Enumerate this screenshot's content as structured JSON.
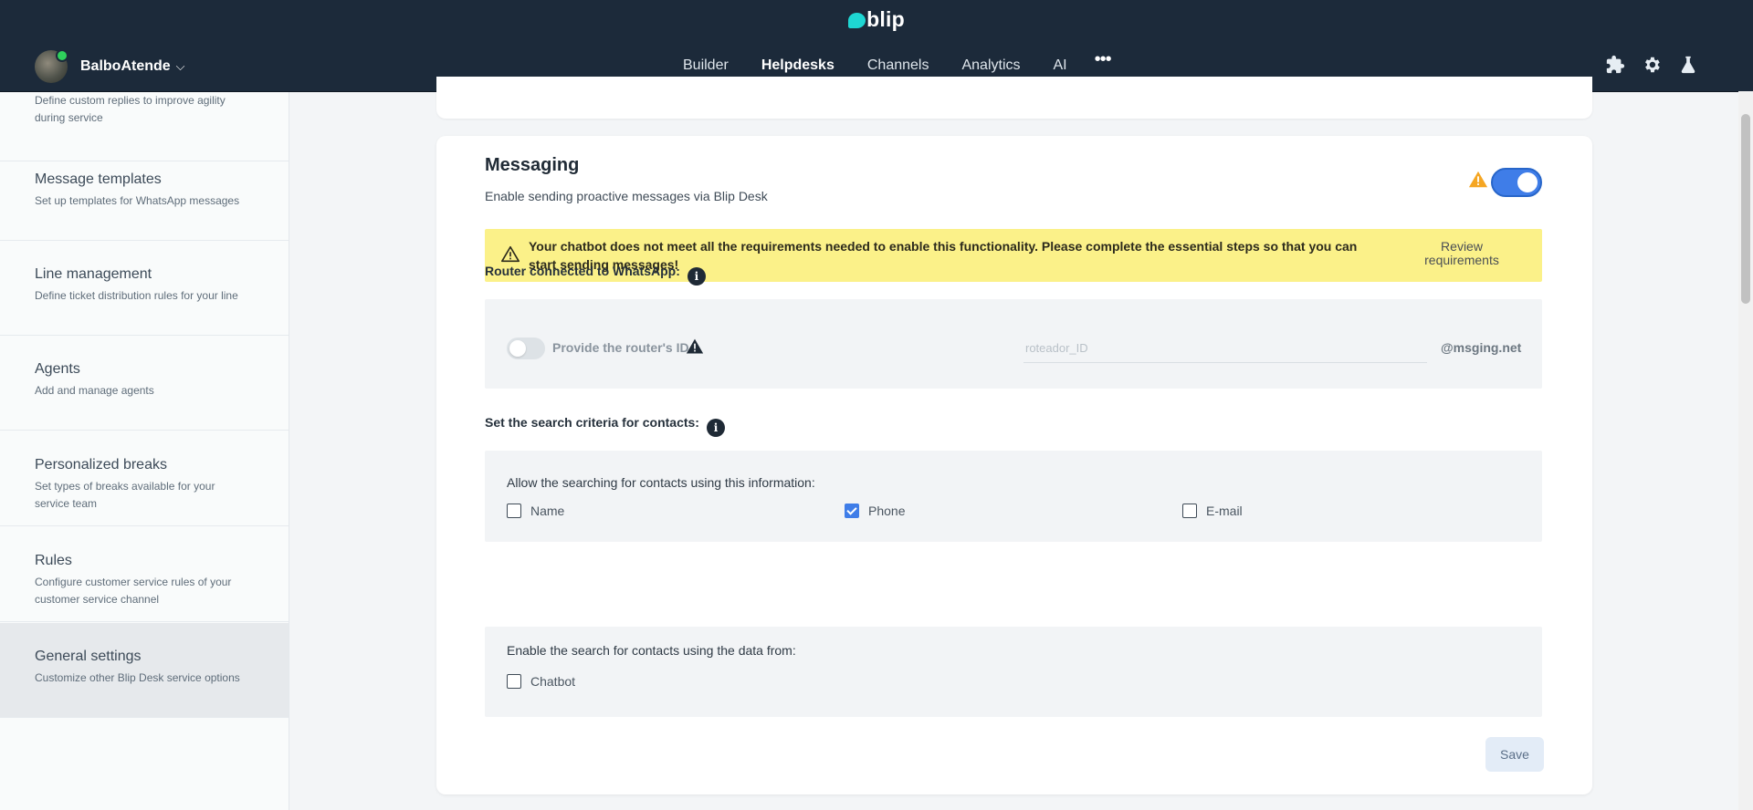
{
  "header": {
    "logo": "blip",
    "user": {
      "name": "BalboAtende",
      "chevron": "⌵"
    },
    "nav": [
      {
        "label": "Builder",
        "active": false
      },
      {
        "label": "Helpdesks",
        "active": true
      },
      {
        "label": "Channels",
        "active": false
      },
      {
        "label": "Analytics",
        "active": false
      },
      {
        "label": "AI",
        "active": false
      }
    ],
    "more": "•••",
    "tools": [
      "extensions-icon",
      "settings-gear-icon",
      "flask-icon"
    ]
  },
  "sidebar": {
    "items": [
      {
        "title": "",
        "desc": "Define custom replies to improve agility during service"
      },
      {
        "title": "Message templates",
        "desc": "Set up templates for WhatsApp messages"
      },
      {
        "title": "Line management",
        "desc": "Define ticket distribution rules for your line"
      },
      {
        "title": "Agents",
        "desc": "Add and manage agents"
      },
      {
        "title": "Personalized breaks",
        "desc": "Set types of breaks available for your service team"
      },
      {
        "title": "Rules",
        "desc": "Configure customer service rules of your customer service channel"
      },
      {
        "title": "General settings",
        "desc": "Customize other Blip Desk service options",
        "selected": true
      }
    ]
  },
  "messaging": {
    "title": "Messaging",
    "subtitle": "Enable sending proactive messages via Blip Desk",
    "enabled": true,
    "alert": {
      "text": "Your chatbot does not meet all the requirements needed to enable this functionality. Please complete the essential steps so that you can start sending messages!",
      "button": "Review requirements"
    },
    "router": {
      "label": "Router connected to WhatsApp:",
      "toggle_label": "Provide the router's ID",
      "toggle_on": false,
      "input_placeholder": "roteador_ID",
      "input_value": "",
      "suffix": "@msging.net"
    },
    "search": {
      "label": "Set the search criteria for contacts:",
      "info_panel_label": "Allow the searching for contacts using this information:",
      "options": [
        {
          "label": "Name",
          "checked": false
        },
        {
          "label": "Phone",
          "checked": true
        },
        {
          "label": "E-mail",
          "checked": false
        }
      ],
      "source_label": "Enable the search for contacts using the data from:",
      "sources": [
        {
          "label": "Chatbot",
          "checked": false
        }
      ]
    },
    "save_label": "Save"
  },
  "colors": {
    "header_bg": "#1c2a3a",
    "accent": "#3f7de8",
    "alert_bg": "#fbf189",
    "warning": "#f5a623",
    "active_tab_underline": "#1ea3ff"
  }
}
